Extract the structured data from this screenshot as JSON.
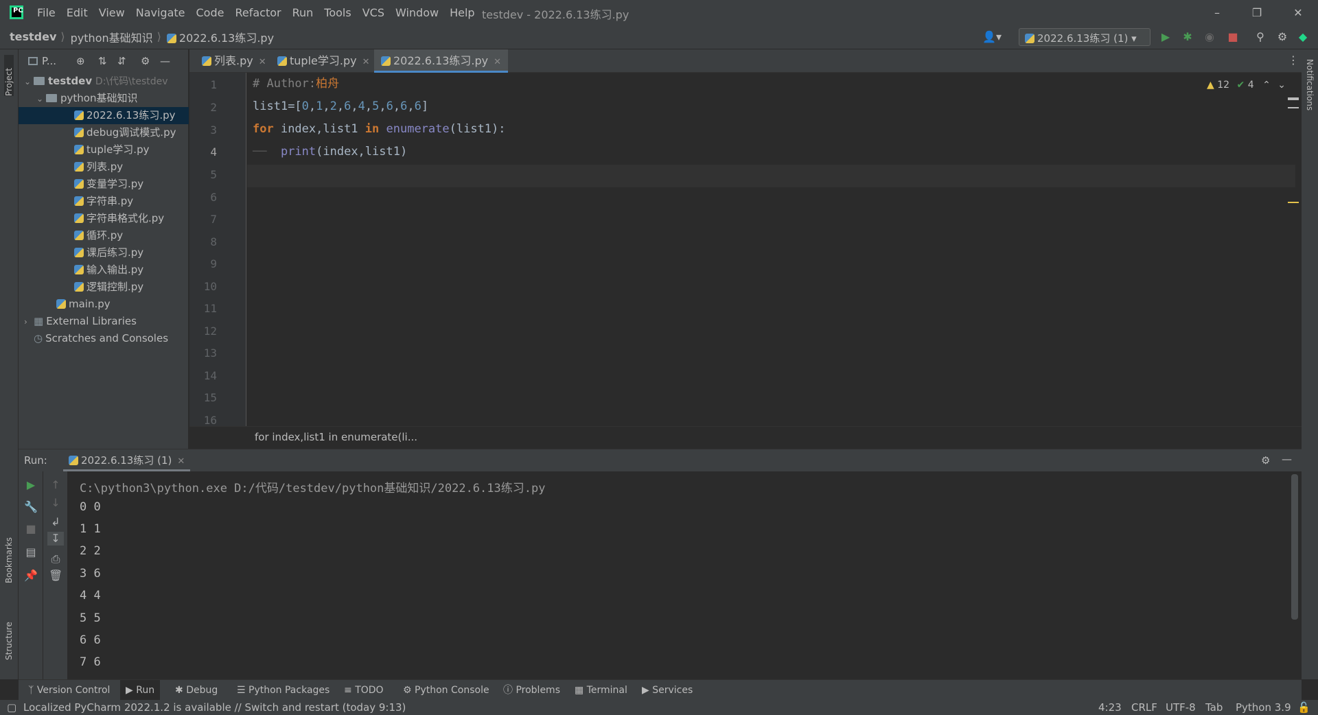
{
  "menu": [
    "File",
    "Edit",
    "View",
    "Navigate",
    "Code",
    "Refactor",
    "Run",
    "Tools",
    "VCS",
    "Window",
    "Help"
  ],
  "window_title": "testdev - 2022.6.13练习.py",
  "breadcrumb": [
    "testdev",
    "python基础知识",
    "2022.6.13练习.py"
  ],
  "run_config": "2022.6.13练习 (1)",
  "left_strip": {
    "project": "Project",
    "bookmarks": "Bookmarks",
    "structure": "Structure"
  },
  "right_strip": {
    "notifications": "Notifications"
  },
  "project": {
    "header": "P...",
    "root": {
      "name": "testdev",
      "path": "D:\\代码\\testdev"
    },
    "folder": "python基础知识",
    "files": [
      "2022.6.13练习.py",
      "debug调试模式.py",
      "tuple学习.py",
      "列表.py",
      "变量学习.py",
      "字符串.py",
      "字符串格式化.py",
      "循环.py",
      "课后练习.py",
      "输入输出.py",
      "逻辑控制.py"
    ],
    "main": "main.py",
    "external": "External Libraries",
    "scratches": "Scratches and Consoles"
  },
  "tabs": [
    "列表.py",
    "tuple学习.py",
    "2022.6.13练习.py"
  ],
  "inspections": {
    "warnings": "12",
    "checks": "4"
  },
  "line_numbers": [
    "1",
    "2",
    "3",
    "4",
    "5",
    "6",
    "7",
    "8",
    "9",
    "10",
    "11",
    "12",
    "13",
    "14",
    "15",
    "16"
  ],
  "code": {
    "l1_comment": "# Author:",
    "l1_author": "柏舟",
    "l2_var": "list1",
    "l2_eq": "=[",
    "l2_nums": [
      "0",
      "1",
      "2",
      "6",
      "4",
      "5",
      "6",
      "6",
      "6"
    ],
    "l2_end": "]",
    "l3_for": "for",
    "l3_mid": " index,list1 ",
    "l3_in": "in",
    "l3_enum": " enumerate",
    "l3_rest": "(list1):",
    "l4_print": "print",
    "l4_args": "(index,list1)"
  },
  "editor_breadcrumb": "for index,list1 in enumerate(li...",
  "run": {
    "label": "Run:",
    "tab": "2022.6.13练习 (1)",
    "command": "C:\\python3\\python.exe D:/代码/testdev/python基础知识/2022.6.13练习.py",
    "output": [
      "0 0",
      "1 1",
      "2 2",
      "3 6",
      "4 4",
      "5 5",
      "6 6",
      "7 6"
    ]
  },
  "bottom_tools": [
    "Version Control",
    "Run",
    "Debug",
    "Python Packages",
    "TODO",
    "Python Console",
    "Problems",
    "Terminal",
    "Services"
  ],
  "status": {
    "message": "Localized PyCharm 2022.1.2 is available // Switch and restart (today 9:13)",
    "position": "4:23",
    "line_sep": "CRLF",
    "encoding": "UTF-8",
    "indent": "Tab",
    "interpreter": "Python 3.9"
  },
  "colors": {
    "accent": "#4a88c7",
    "run_green": "#499c54",
    "stop_red": "#c75450"
  }
}
